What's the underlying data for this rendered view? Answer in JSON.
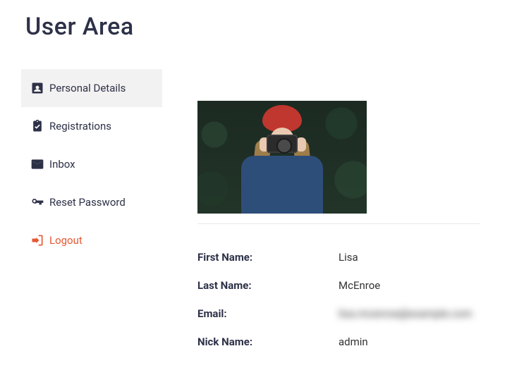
{
  "page_title": "User Area",
  "sidebar": {
    "items": [
      {
        "label": "Personal Details",
        "icon": "account-box-icon",
        "active": true
      },
      {
        "label": "Registrations",
        "icon": "assignment-icon",
        "active": false
      },
      {
        "label": "Inbox",
        "icon": "mail-icon",
        "active": false
      },
      {
        "label": "Reset Password",
        "icon": "key-icon",
        "active": false
      },
      {
        "label": "Logout",
        "icon": "logout-icon",
        "active": false
      }
    ]
  },
  "profile": {
    "first_name_label": "First Name:",
    "first_name": "Lisa",
    "last_name_label": "Last Name:",
    "last_name": "McEnroe",
    "email_label": "Email:",
    "email": "lisa.mcenroe@example.com",
    "nick_name_label": "Nick Name:",
    "nick_name": "admin"
  }
}
